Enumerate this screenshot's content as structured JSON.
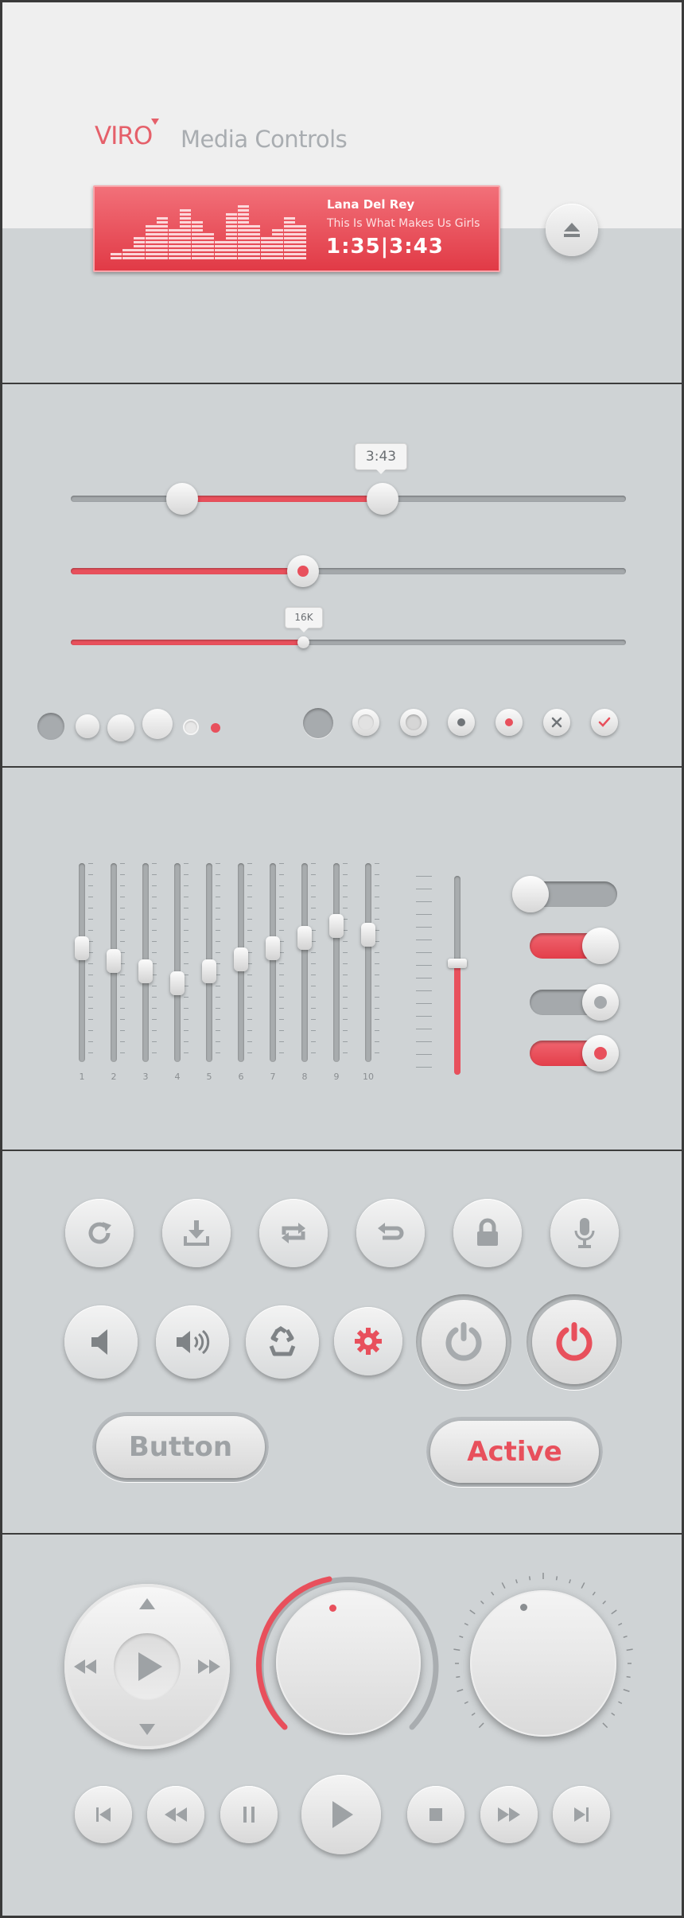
{
  "brand": {
    "logo": "VIRO",
    "subtitle": "Media Controls"
  },
  "player": {
    "artist": "Lana Del Rey",
    "song": "This Is What Makes Us Girls",
    "time": "1:35|3:43"
  },
  "sliders": {
    "range_tooltip": "3:43",
    "range_start": 0.2,
    "range_end": 0.56,
    "volume_level": 0.42,
    "small_tooltip": "16K",
    "small_level": 0.42
  },
  "equalizer": {
    "band_labels": [
      "1",
      "2",
      "3",
      "4",
      "5",
      "6",
      "7",
      "8",
      "9",
      "10"
    ],
    "band_levels": [
      0.58,
      0.51,
      0.45,
      0.38,
      0.45,
      0.52,
      0.58,
      0.64,
      0.71,
      0.66
    ],
    "master_level": 0.58
  },
  "toggles": [
    {
      "name": "toggle-off",
      "state": "off"
    },
    {
      "name": "toggle-on",
      "state": "on"
    },
    {
      "name": "toggle-off-dot",
      "state": "off"
    },
    {
      "name": "toggle-on-dot",
      "state": "on"
    }
  ],
  "buttons": {
    "normal": "Button",
    "active": "Active"
  },
  "colors": {
    "accent": "#e8505c",
    "background": "#cfd3d5",
    "header": "#efefef"
  }
}
